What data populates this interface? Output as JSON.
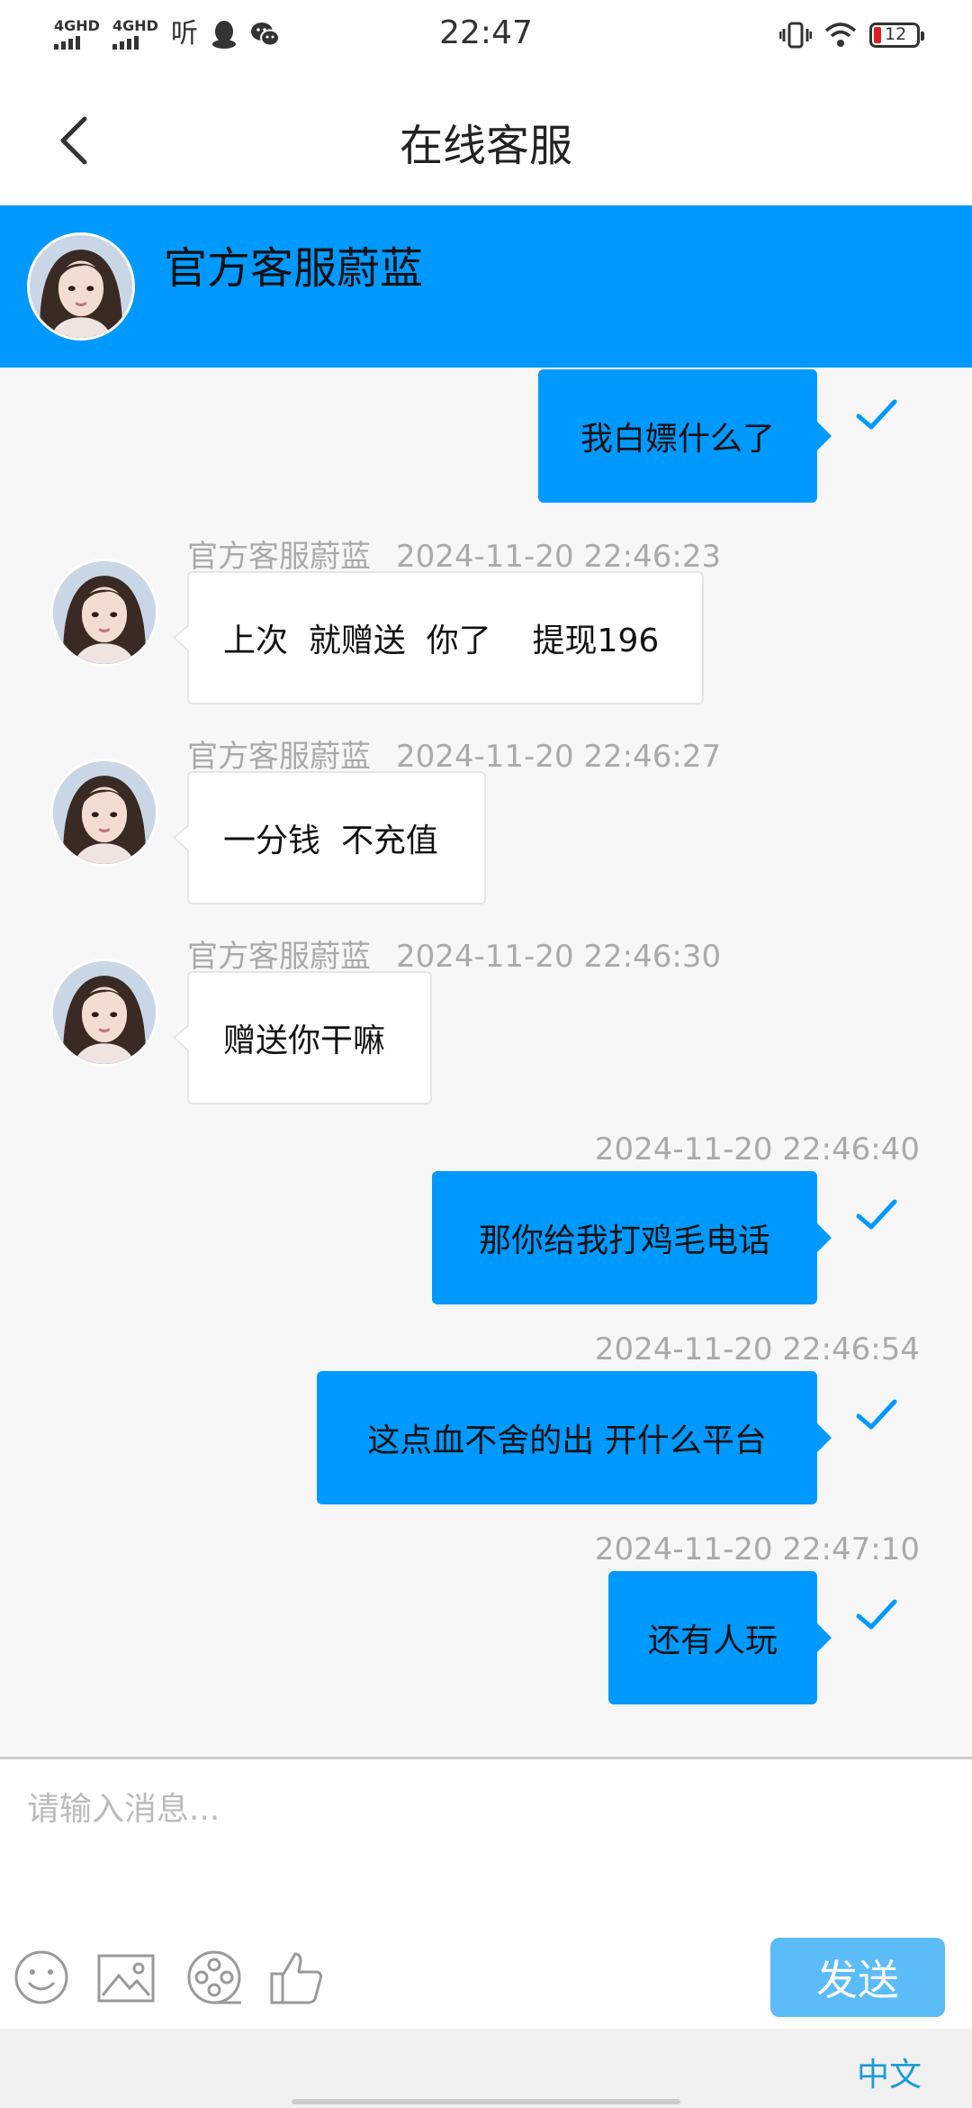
{
  "status_bar": {
    "time": "22:47",
    "signal1": "4GHD",
    "signal2": "4GHD",
    "listen_glyph": "听",
    "battery": "12",
    "icons": [
      "qq-icon",
      "wechat-icon",
      "vibrate-icon",
      "wifi-icon",
      "battery-icon"
    ]
  },
  "header": {
    "title": "在线客服",
    "back_icon": "chevron-left-icon"
  },
  "agent": {
    "name": "官方客服蔚蓝"
  },
  "messages": [
    {
      "dir": "out",
      "text": "我白嫖什么了",
      "time": ""
    },
    {
      "dir": "in",
      "sender": "官方客服蔚蓝",
      "time": "2024-11-20 22:46:23",
      "text": "上次  就赠送  你了    提现196"
    },
    {
      "dir": "in",
      "sender": "官方客服蔚蓝",
      "time": "2024-11-20 22:46:27",
      "text": "一分钱  不充值"
    },
    {
      "dir": "in",
      "sender": "官方客服蔚蓝",
      "time": "2024-11-20 22:46:30",
      "text": "赠送你干嘛"
    },
    {
      "dir": "out",
      "time": "2024-11-20 22:46:40",
      "text": "那你给我打鸡毛电话"
    },
    {
      "dir": "out",
      "time": "2024-11-20 22:46:54",
      "text": "这点血不舍的出 开什么平台"
    },
    {
      "dir": "out",
      "time": "2024-11-20 22:47:10",
      "text": "还有人玩"
    }
  ],
  "input": {
    "placeholder": "请输入消息...",
    "send_label": "发送"
  },
  "toolbar": [
    "emoji-icon",
    "image-icon",
    "video-icon",
    "thumbs-up-icon"
  ],
  "ime": {
    "language": "中文"
  },
  "colors": {
    "accent": "#0099ff",
    "send_button": "#5bbcf8",
    "ime_text": "#1a9ad6"
  }
}
